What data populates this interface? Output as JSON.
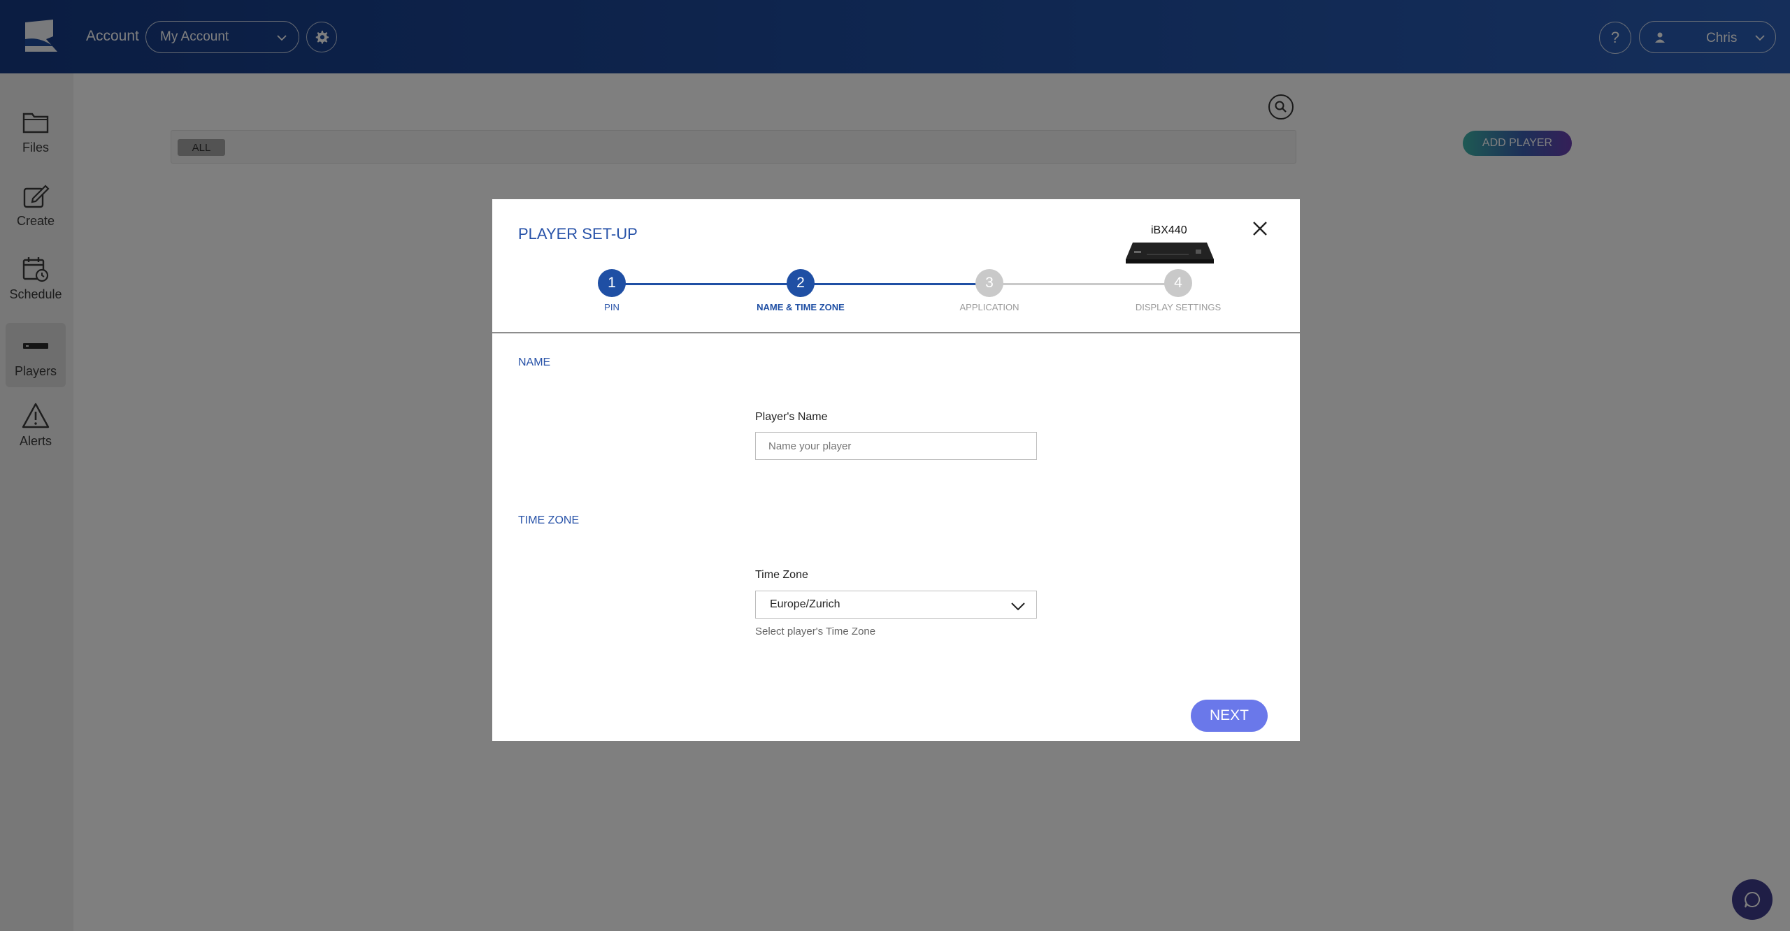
{
  "header": {
    "account_label": "Account",
    "account_value": "My Account",
    "help_label": "?",
    "user_name": "Chris"
  },
  "sidebar": {
    "items": [
      {
        "label": "Files",
        "icon": "folder-icon",
        "active": false
      },
      {
        "label": "Create",
        "icon": "edit-icon",
        "active": false
      },
      {
        "label": "Schedule",
        "icon": "calendar-clock-icon",
        "active": false
      },
      {
        "label": "Players",
        "icon": "player-device-icon",
        "active": true
      },
      {
        "label": "Alerts",
        "icon": "alert-triangle-icon",
        "active": false
      }
    ]
  },
  "main": {
    "filter_chip": "ALL",
    "add_player_label": "ADD PLAYER"
  },
  "modal": {
    "title": "PLAYER SET-UP",
    "device_name": "iBX440",
    "steps": [
      {
        "number": "1",
        "label": "PIN",
        "state": "done"
      },
      {
        "number": "2",
        "label": "NAME & TIME ZONE",
        "state": "current"
      },
      {
        "number": "3",
        "label": "APPLICATION",
        "state": "todo"
      },
      {
        "number": "4",
        "label": "DISPLAY SETTINGS",
        "state": "todo"
      }
    ],
    "name_section": {
      "title": "NAME",
      "field_label": "Player's Name",
      "placeholder": "Name your player",
      "value": ""
    },
    "timezone_section": {
      "title": "TIME ZONE",
      "field_label": "Time Zone",
      "selected": "Europe/Zurich",
      "hint": "Select player's Time Zone"
    },
    "next_label": "NEXT"
  },
  "colors": {
    "brand_blue": "#1f4fa4",
    "next_button": "#6a78ea",
    "step_inactive": "#c9c9c9"
  }
}
